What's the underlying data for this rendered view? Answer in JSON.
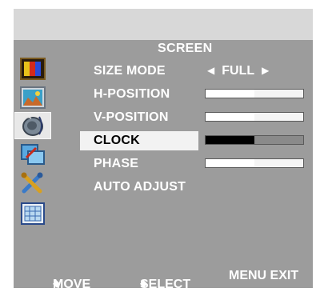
{
  "menu": {
    "title": "SCREEN",
    "icons": [
      {
        "name": "picture-color-icon"
      },
      {
        "name": "screen-image-icon"
      },
      {
        "name": "audio-speaker-icon"
      },
      {
        "name": "screen-adjust-icon"
      },
      {
        "name": "tools-icon"
      },
      {
        "name": "grid-options-icon"
      }
    ],
    "items": [
      {
        "label": "SIZE MODE",
        "value": "FULL",
        "type": "selector"
      },
      {
        "label": "H-POSITION",
        "type": "slider",
        "level": 0.5
      },
      {
        "label": "V-POSITION",
        "type": "slider",
        "level": 0.5
      },
      {
        "label": "CLOCK",
        "type": "slider",
        "level": 0.5,
        "selected": true
      },
      {
        "label": "PHASE",
        "type": "slider",
        "level": 0.5
      },
      {
        "label": "AUTO ADJUST",
        "type": "action"
      }
    ]
  },
  "footer": {
    "move": "MOVE",
    "select": "SELECT",
    "exit": "MENU EXIT"
  },
  "colors": {
    "panel": "#9c9c9c",
    "header": "#d8d8d8",
    "highlight": "#f2f2f2",
    "text": "#ffffff"
  }
}
